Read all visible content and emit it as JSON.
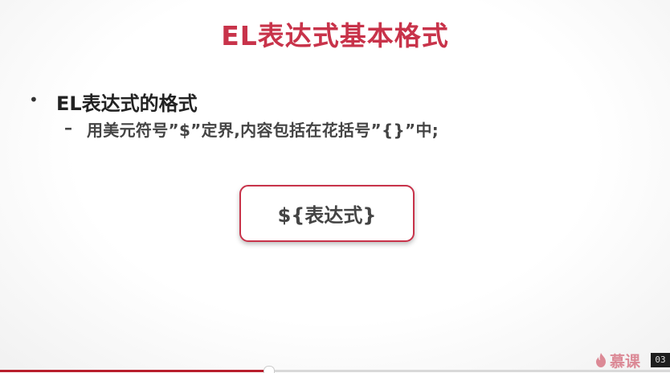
{
  "slide": {
    "title": "EL表达式基本格式",
    "bullet": {
      "marker": "•",
      "text": "EL表达式的格式"
    },
    "sub_bullet": {
      "marker": "–",
      "text": "用美元符号”$”定界,内容包括在花括号”{}”中;"
    },
    "code_box": {
      "text": "${表达式}"
    }
  },
  "player": {
    "progress_fraction": 0.4,
    "logo_text": "慕课",
    "page_number": "03"
  },
  "colors": {
    "title": "#c8334a",
    "accent_border": "#c8334a",
    "progress": "#b81e2c",
    "text": "#444444"
  },
  "icons": [
    "flame-logo-icon"
  ]
}
